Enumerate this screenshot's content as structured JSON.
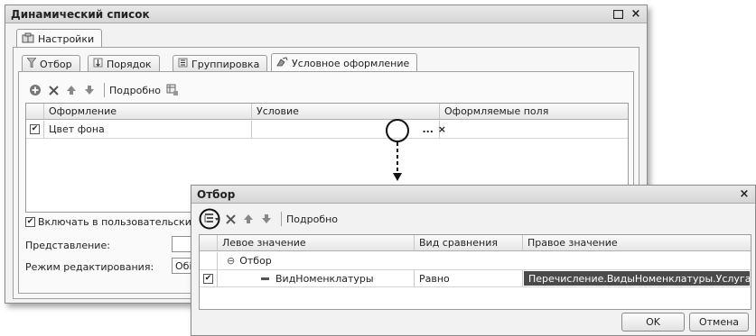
{
  "main_window": {
    "title": "Динамический список",
    "tab_settings": "Настройки",
    "inner_tabs": [
      "Отбор",
      "Порядок",
      "Группировка",
      "Условное оформление"
    ],
    "toolbar": {
      "details_label": "Подробно"
    },
    "grid": {
      "columns": [
        "Оформление",
        "Условие",
        "Оформляемые поля"
      ],
      "rows": [
        {
          "checked": true,
          "appearance": "Цвет фона",
          "condition_button": "...",
          "clear_icon": "×"
        }
      ]
    },
    "include_user_settings": "Включать в пользовательские н",
    "representation_label": "Представление:",
    "edit_mode_label": "Режим редактирования:",
    "edit_mode_value": "Обі"
  },
  "filter_window": {
    "title": "Отбор",
    "close": "×",
    "toolbar": {
      "details_label": "Подробно"
    },
    "grid": {
      "columns": [
        "Левое значение",
        "Вид сравнения",
        "Правое значение"
      ],
      "group_row": {
        "toggle": "⊖",
        "label": "Отбор"
      },
      "item_row": {
        "checked": true,
        "left": "ВидНоменклатуры",
        "comparison": "Равно",
        "right": "Перечисление.ВидыНоменклатуры.Услуга"
      }
    },
    "buttons": {
      "ok": "OK",
      "cancel": "Отмена"
    }
  }
}
